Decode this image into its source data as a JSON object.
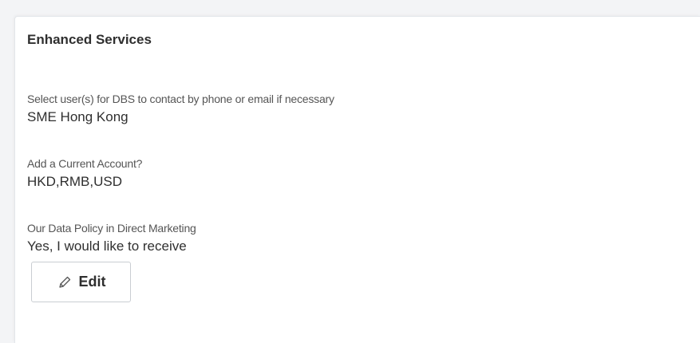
{
  "section": {
    "title": "Enhanced Services"
  },
  "fields": {
    "contact": {
      "label": "Select user(s) for DBS to contact by phone or email if necessary",
      "value": "SME Hong Kong"
    },
    "current_account": {
      "label": "Add a Current Account?",
      "value": "HKD,RMB,USD"
    },
    "data_policy": {
      "label": "Our Data Policy in Direct Marketing",
      "value": "Yes, I would like to receive"
    }
  },
  "actions": {
    "edit_label": "Edit",
    "edit_icon": "pencil-icon"
  },
  "colors": {
    "background": "#f3f4f6",
    "card": "#ffffff",
    "text_primary": "#2f2f2f",
    "text_secondary": "#555555",
    "border": "#c9cdd2"
  }
}
